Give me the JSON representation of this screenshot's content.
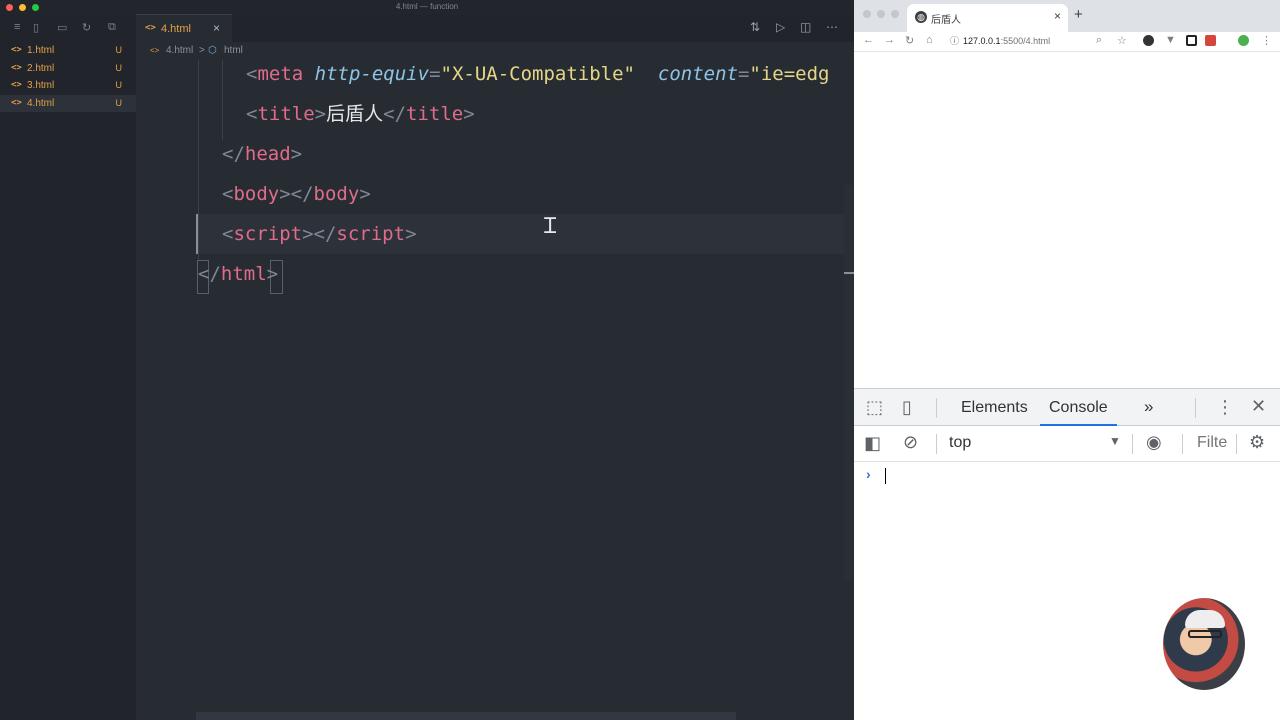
{
  "window": {
    "title": "4.html — function"
  },
  "sidebar": {
    "files": [
      {
        "name": "1.html",
        "status": "U",
        "active": false
      },
      {
        "name": "2.html",
        "status": "U",
        "active": false
      },
      {
        "name": "3.html",
        "status": "U",
        "active": false
      },
      {
        "name": "4.html",
        "status": "U",
        "active": true
      }
    ]
  },
  "tab": {
    "label": "4.html",
    "icon": "<>",
    "close": "×"
  },
  "breadcrumb": {
    "file": "4.html",
    "separator": ">",
    "node": "html"
  },
  "code": {
    "lines": [
      {
        "indent": "    ",
        "tokens": [
          [
            "p",
            "<"
          ],
          [
            "t",
            "meta"
          ],
          [
            "w",
            " "
          ],
          [
            "a",
            "http-equiv"
          ],
          [
            "p",
            "="
          ],
          [
            "s",
            "\"X-UA-Compatible\""
          ],
          [
            "w",
            "  "
          ],
          [
            "a",
            "content"
          ],
          [
            "p",
            "="
          ],
          [
            "s",
            "\"ie=edg"
          ]
        ]
      },
      {
        "indent": "    ",
        "tokens": [
          [
            "p",
            "<"
          ],
          [
            "t",
            "title"
          ],
          [
            "p",
            ">"
          ],
          [
            "w",
            "后盾人"
          ],
          [
            "p",
            "</"
          ],
          [
            "t",
            "title"
          ],
          [
            "p",
            ">"
          ]
        ]
      },
      {
        "indent": "  ",
        "tokens": [
          [
            "p",
            "</"
          ],
          [
            "t",
            "head"
          ],
          [
            "p",
            ">"
          ]
        ]
      },
      {
        "indent": "  ",
        "tokens": [
          [
            "p",
            "<"
          ],
          [
            "t",
            "body"
          ],
          [
            "p",
            "></"
          ],
          [
            "t",
            "body"
          ],
          [
            "p",
            ">"
          ]
        ]
      },
      {
        "indent": "  ",
        "tokens": [
          [
            "p",
            "<"
          ],
          [
            "t",
            "script"
          ],
          [
            "p",
            "></"
          ],
          [
            "t",
            "script"
          ],
          [
            "p",
            ">"
          ]
        ]
      },
      {
        "indent": "",
        "tokens": [
          [
            "p",
            "</"
          ],
          [
            "t",
            "html"
          ],
          [
            "p",
            ">"
          ]
        ]
      }
    ]
  },
  "browser": {
    "tab_title": "后盾人",
    "tab_close": "×",
    "new_tab": "+",
    "url_host": "127.0.0.1",
    "url_rest": ":5500/4.html",
    "devtools": {
      "tabs": [
        "Elements",
        "Console"
      ],
      "active_tab": "Console",
      "more": "»",
      "context": "top",
      "filter_placeholder": "Filte",
      "prompt": "›"
    }
  },
  "colors": {
    "editor_bg": "#272c33",
    "tag": "#e06c8a",
    "attr": "#8fc4e6",
    "string": "#e5d687",
    "file_modified": "#e5a048",
    "console_tab_underline": "#1a73e8"
  }
}
